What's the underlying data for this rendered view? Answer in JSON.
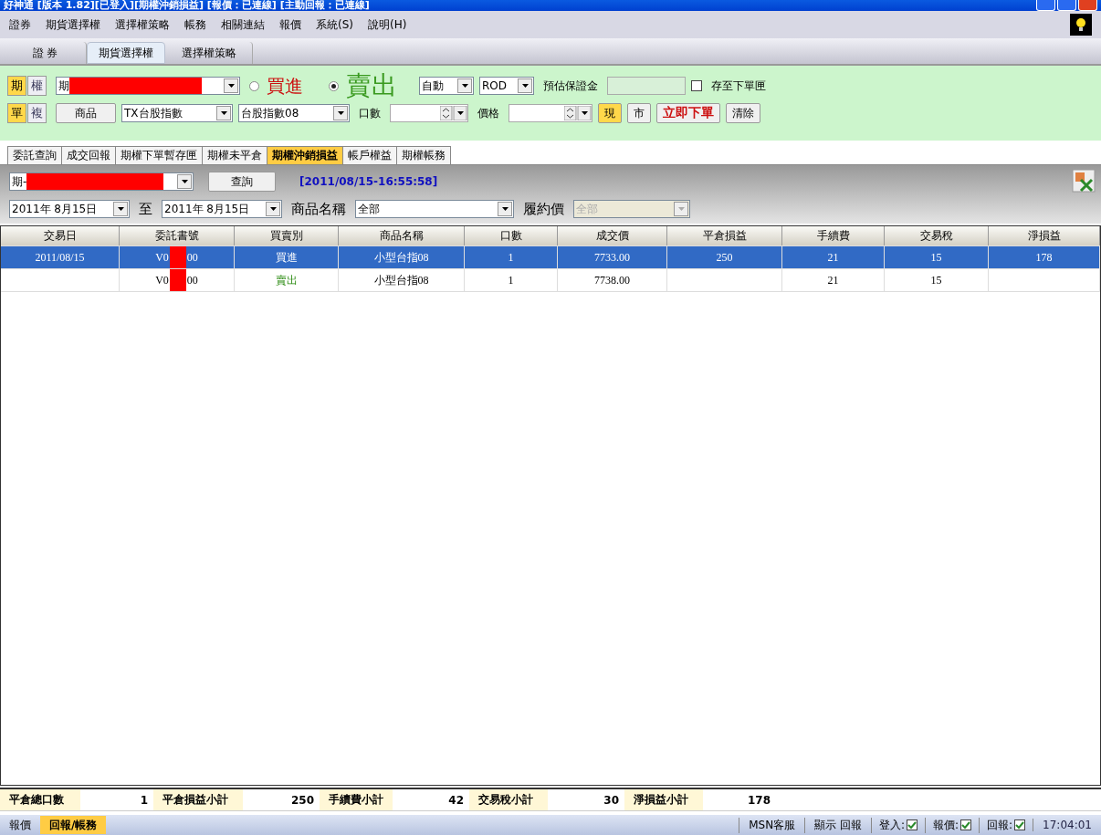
{
  "window": {
    "title": "好神通 [版本 1.82][已登入][期權沖銷損益] [報價：已連線] [主動回報：已連線]"
  },
  "menu": [
    "證券",
    "期貨選擇權",
    "選擇權策略",
    "帳務",
    "相關連結",
    "報價",
    "系統(S)",
    "說明(H)"
  ],
  "main_tabs": [
    {
      "label": "證 券",
      "selected": false
    },
    {
      "label": "期貨選擇權",
      "selected": true
    },
    {
      "label": "選擇權策略",
      "selected": false
    }
  ],
  "order": {
    "type_toggle": [
      {
        "label": "期",
        "selected": true
      },
      {
        "label": "權",
        "selected": false
      }
    ],
    "mode_toggle": [
      {
        "label": "單",
        "selected": true
      },
      {
        "label": "複",
        "selected": false
      }
    ],
    "account": {
      "value": "期",
      "redacted": true
    },
    "sides": [
      {
        "label": "買進",
        "selected": false,
        "kind": "buy"
      },
      {
        "label": "賣出",
        "selected": true,
        "kind": "sell"
      }
    ],
    "open_close": "自動",
    "condition": "ROD",
    "margin_label": "預估保證金",
    "save_checkbox": {
      "label": "存至下單匣",
      "checked": false
    },
    "product_button": "商品",
    "product": "TX台股指數",
    "contract": "台股指數08",
    "qty_label": "口數",
    "price_label": "價格",
    "price_buttons": [
      {
        "label": "現",
        "selected": true
      },
      {
        "label": "市",
        "selected": false
      }
    ],
    "submit": "立即下單",
    "clear": "清除"
  },
  "sub_tabs": [
    {
      "label": "委託查詢",
      "selected": false
    },
    {
      "label": "成交回報",
      "selected": false
    },
    {
      "label": "期權下單暫存匣",
      "selected": false
    },
    {
      "label": "期權未平倉",
      "selected": false
    },
    {
      "label": "期權沖銷損益",
      "selected": true
    },
    {
      "label": "帳戶權益",
      "selected": false
    },
    {
      "label": "期權帳務",
      "selected": false
    }
  ],
  "query": {
    "account": {
      "value": "期-",
      "redacted": true
    },
    "query_button": "查詢",
    "timestamp": "[2011/08/15-16:55:58]",
    "from_date": "2011年  8月15日",
    "to_label": "至",
    "to_date": "2011年  8月15日",
    "product_label": "商品名稱",
    "product": "全部",
    "strike_label": "履約價",
    "strike": {
      "value": "全部",
      "disabled": true
    }
  },
  "table": {
    "columns": [
      "交易日",
      "委託書號",
      "買賣別",
      "商品名稱",
      "口數",
      "成交價",
      "平倉損益",
      "手續費",
      "交易稅",
      "淨損益"
    ],
    "rows": [
      {
        "selected": true,
        "kind": "buy",
        "redacted": true,
        "cells": [
          "2011/08/15",
          [
            "V0",
            "00"
          ],
          "買進",
          "小型台指08",
          "1",
          "7733.00",
          "250",
          "21",
          "15",
          "178"
        ]
      },
      {
        "selected": false,
        "kind": "sell",
        "redacted": true,
        "cells": [
          "",
          [
            "V0",
            "00"
          ],
          "賣出",
          "小型台指08",
          "1",
          "7738.00",
          "",
          "21",
          "15",
          ""
        ]
      }
    ]
  },
  "summary": [
    {
      "label": "平倉總口數",
      "value": "1"
    },
    {
      "label": "平倉損益小計",
      "value": "250"
    },
    {
      "label": "手續費小計",
      "value": "42"
    },
    {
      "label": "交易稅小計",
      "value": "30"
    },
    {
      "label": "淨損益小計",
      "value": "178"
    }
  ],
  "status_bar": {
    "tabs": [
      {
        "label": "報價",
        "selected": false
      },
      {
        "label": "回報/帳務",
        "selected": true
      }
    ],
    "items": [
      "MSN客服",
      "顯示 回報"
    ],
    "checks": [
      {
        "label": "登入:",
        "checked": true
      },
      {
        "label": "報價:",
        "checked": true
      },
      {
        "label": "回報:",
        "checked": true
      }
    ],
    "time": "17:04:01"
  }
}
